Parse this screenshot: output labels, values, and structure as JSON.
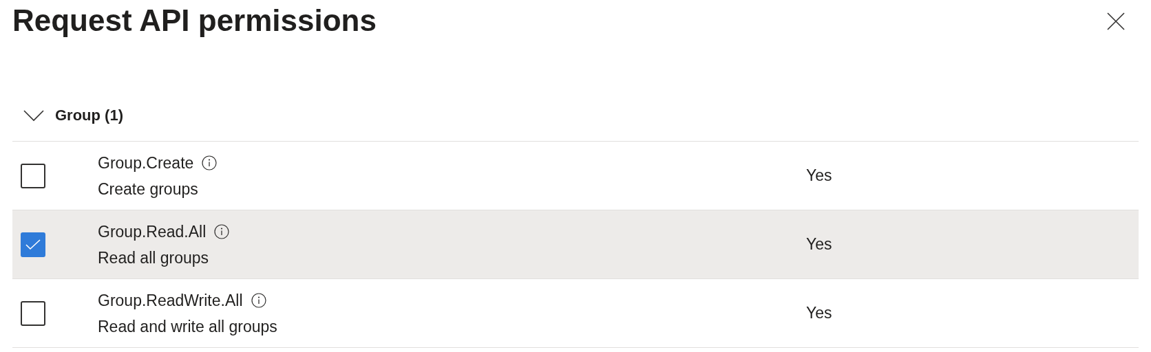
{
  "title": "Request API permissions",
  "group": {
    "label": "Group (1)",
    "expanded": true,
    "permissions": [
      {
        "name": "Group.Create",
        "description": "Create groups",
        "consent": "Yes",
        "checked": false,
        "selected": false
      },
      {
        "name": "Group.Read.All",
        "description": "Read all groups",
        "consent": "Yes",
        "checked": true,
        "selected": true
      },
      {
        "name": "Group.ReadWrite.All",
        "description": "Read and write all groups",
        "consent": "Yes",
        "checked": false,
        "selected": false
      }
    ]
  }
}
